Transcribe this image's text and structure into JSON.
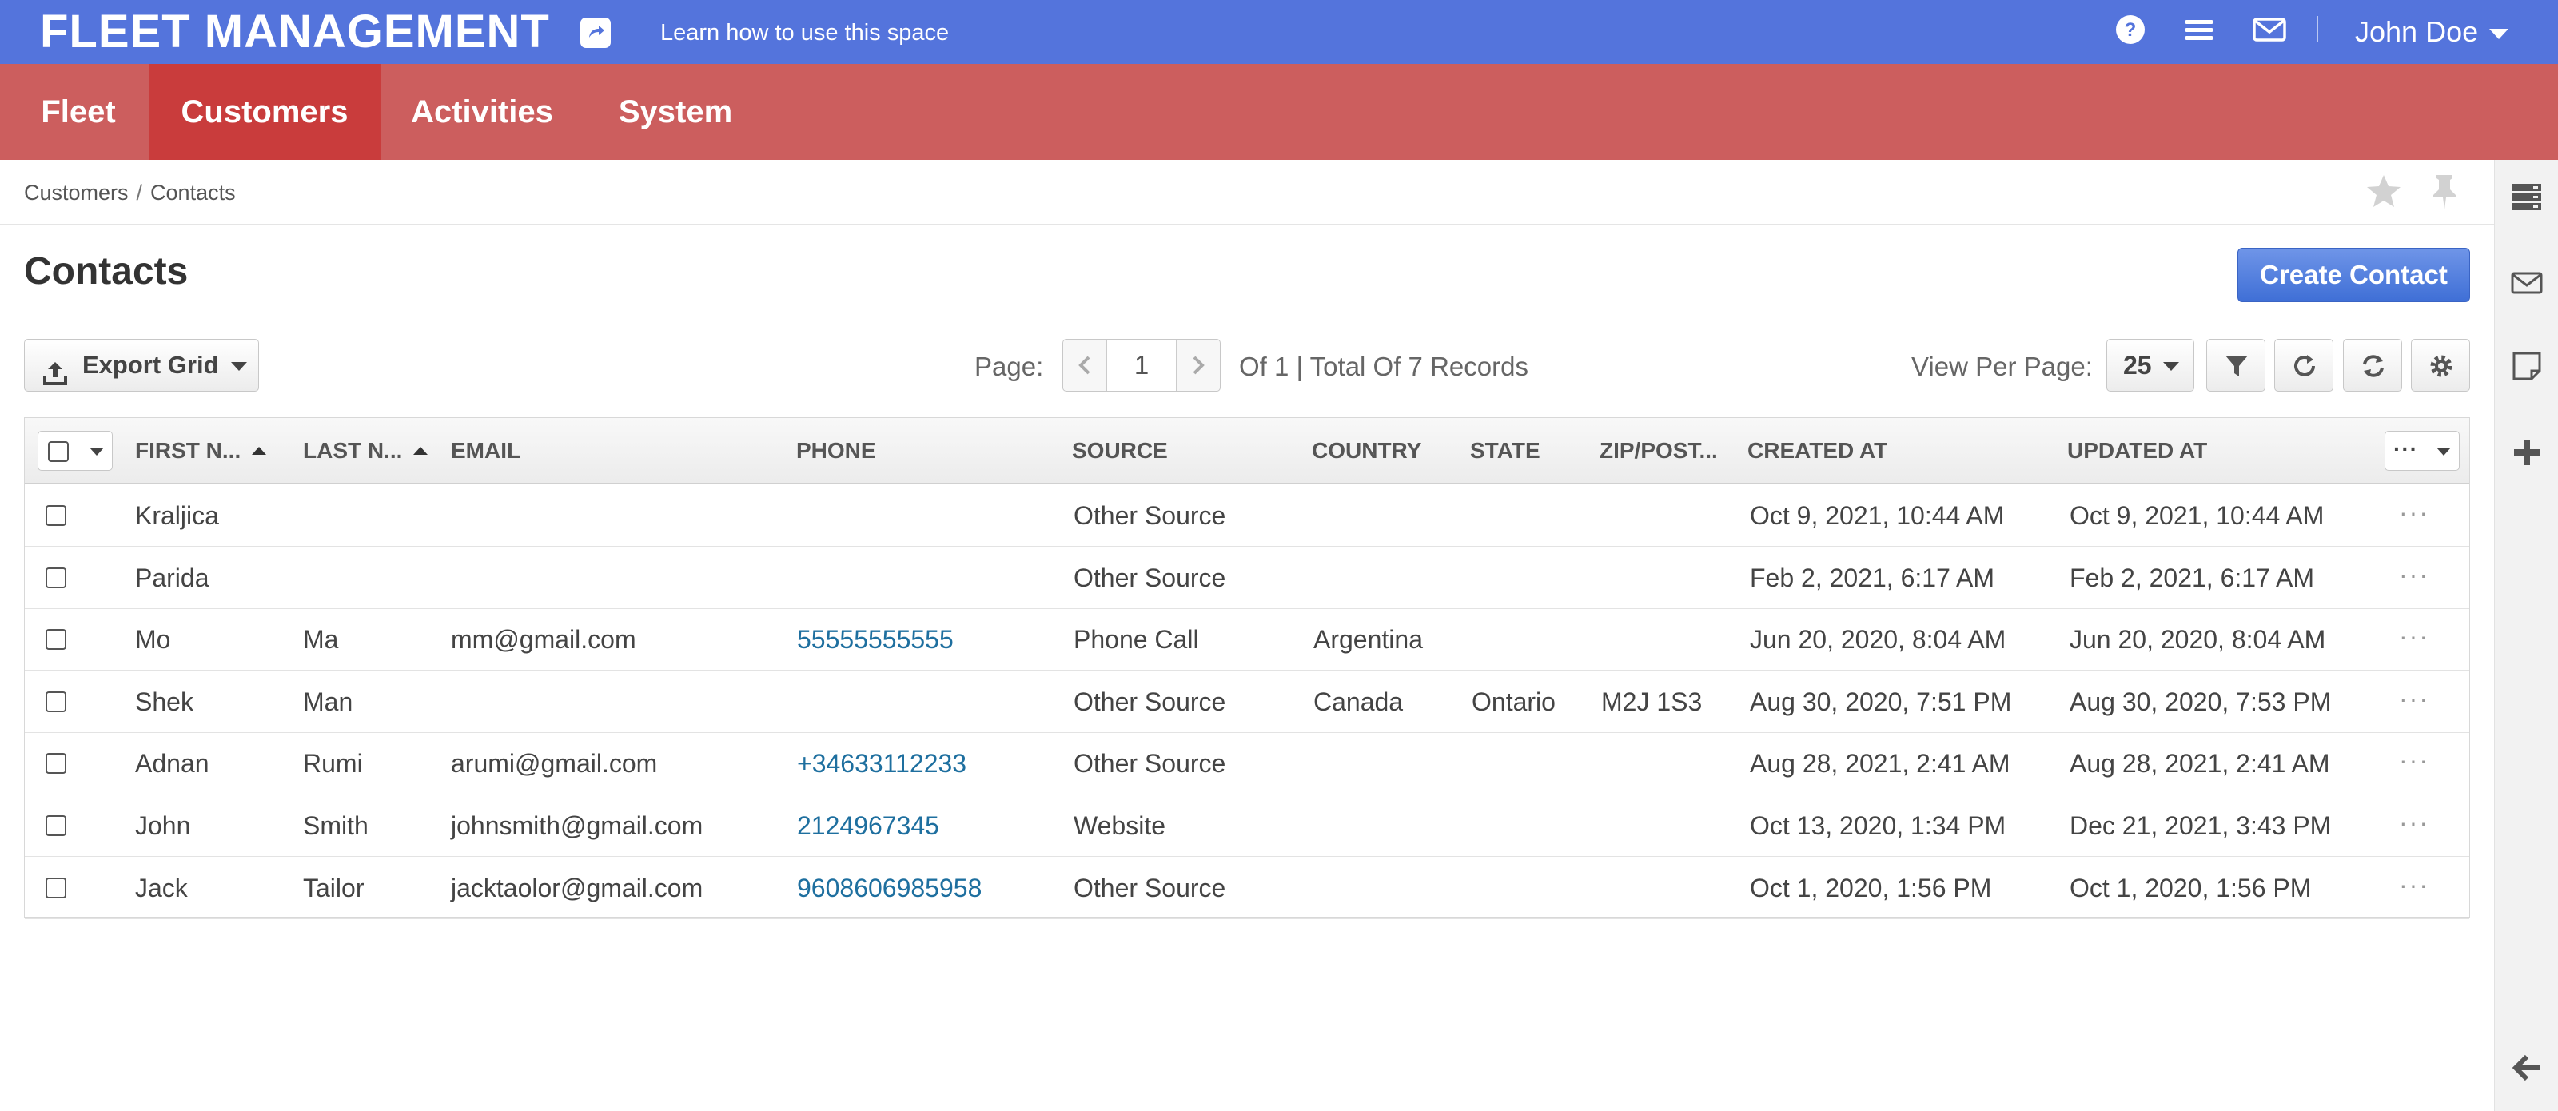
{
  "topbar": {
    "brand": "FLEET MANAGEMENT",
    "learn_link": "Learn how to use this space",
    "user_name": "John Doe",
    "icons": [
      "share-icon",
      "help-icon",
      "menu-icon",
      "mail-icon"
    ]
  },
  "mainnav": {
    "tabs": [
      {
        "label": "Fleet",
        "active": false
      },
      {
        "label": "Customers",
        "active": true
      },
      {
        "label": "Activities",
        "active": false
      },
      {
        "label": "System",
        "active": false
      }
    ]
  },
  "breadcrumb": {
    "parent": "Customers",
    "separator": "/",
    "current": "Contacts"
  },
  "page": {
    "title": "Contacts",
    "create_button": "Create Contact"
  },
  "toolbar": {
    "export_label": "Export Grid",
    "page_label": "Page:",
    "page_value": "1",
    "page_total": "Of 1 |  Total Of 7 Records",
    "view_per_page_label": "View Per Page:",
    "view_per_page_value": "25"
  },
  "grid": {
    "columns": [
      "FIRST N...",
      "LAST N...",
      "EMAIL",
      "PHONE",
      "SOURCE",
      "COUNTRY",
      "STATE",
      "ZIP/POST...",
      "CREATED AT",
      "UPDATED AT"
    ],
    "rows": [
      {
        "first": "Kraljica",
        "last": "",
        "email": "",
        "phone": "",
        "source": "Other Source",
        "country": "",
        "state": "",
        "zip": "",
        "created": "Oct 9, 2021, 10:44 AM",
        "updated": "Oct 9, 2021, 10:44 AM"
      },
      {
        "first": "Parida",
        "last": "",
        "email": "",
        "phone": "",
        "source": "Other Source",
        "country": "",
        "state": "",
        "zip": "",
        "created": "Feb 2, 2021, 6:17 AM",
        "updated": "Feb 2, 2021, 6:17 AM"
      },
      {
        "first": "Mo",
        "last": "Ma",
        "email": "mm@gmail.com",
        "phone": "55555555555",
        "source": "Phone Call",
        "country": "Argentina",
        "state": "",
        "zip": "",
        "created": "Jun 20, 2020, 8:04 AM",
        "updated": "Jun 20, 2020, 8:04 AM"
      },
      {
        "first": "Shek",
        "last": "Man",
        "email": "",
        "phone": "",
        "source": "Other Source",
        "country": "Canada",
        "state": "Ontario",
        "zip": "M2J 1S3",
        "created": "Aug 30, 2020, 7:51 PM",
        "updated": "Aug 30, 2020, 7:53 PM"
      },
      {
        "first": "Adnan",
        "last": "Rumi",
        "email": "arumi@gmail.com",
        "phone": "+34633112233",
        "source": "Other Source",
        "country": "",
        "state": "",
        "zip": "",
        "created": "Aug 28, 2021, 2:41 AM",
        "updated": "Aug 28, 2021, 2:41 AM"
      },
      {
        "first": "John",
        "last": "Smith",
        "email": "johnsmith@gmail.com",
        "phone": "2124967345",
        "source": "Website",
        "country": "",
        "state": "",
        "zip": "",
        "created": "Oct 13, 2020, 1:34 PM",
        "updated": "Dec 21, 2021, 3:43 PM"
      },
      {
        "first": "Jack",
        "last": "Tailor",
        "email": "jacktaolor@gmail.com",
        "phone": "9608606985958",
        "source": "Other Source",
        "country": "",
        "state": "",
        "zip": "",
        "created": "Oct 1, 2020, 1:56 PM",
        "updated": "Oct 1, 2020, 1:56 PM"
      }
    ],
    "row_action": "···",
    "column_menu": "···"
  },
  "colors": {
    "topbar": "#5474dc",
    "nav": "#cc5e5e",
    "nav_active": "#c93c3c",
    "primary_button": "#4a78dc",
    "link": "#1e6f9f"
  }
}
